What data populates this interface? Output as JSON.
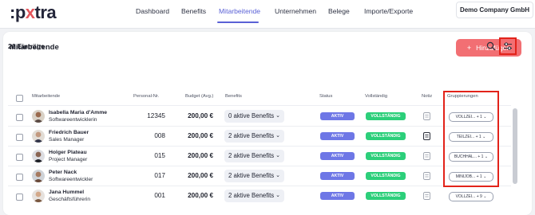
{
  "logo": {
    "pre": ":p",
    "dot": "x",
    "post": "tra"
  },
  "nav": [
    {
      "label": "Dashboard",
      "active": false
    },
    {
      "label": "Benefits",
      "active": false
    },
    {
      "label": "Mitarbeitende",
      "active": true
    },
    {
      "label": "Unternehmen",
      "active": false
    },
    {
      "label": "Belege",
      "active": false
    },
    {
      "label": "Importe/Exporte",
      "active": false
    }
  ],
  "company": "Demo Company GmbH",
  "page": {
    "title": "Mitarbeitende",
    "add_label": "Hinzufügen",
    "count": "26 Einträge"
  },
  "table": {
    "headers": [
      "Mitarbeitende",
      "Personal-Nr.",
      "Budget (Avg.)",
      "Benefits",
      "Status",
      "Vollständig",
      "Notiz",
      "Gruppierungen"
    ],
    "rows": [
      {
        "name": "Isabella Maria d'Amme",
        "role": "Softwareentwicklerin",
        "pnr": "12345",
        "budget": "200,00 €",
        "benefits": "0 aktive Benefits",
        "status": "AKTIV",
        "complete": "VOLLSTÄNDIG",
        "note_filled": false,
        "group": "VOLLZEI... + 1"
      },
      {
        "name": "Friedrich Bauer",
        "role": "Sales Manager",
        "pnr": "008",
        "budget": "200,00 €",
        "benefits": "2 aktive Benefits",
        "status": "AKTIV",
        "complete": "VOLLSTÄNDIG",
        "note_filled": true,
        "group": "TEILZEI... + 1"
      },
      {
        "name": "Holger Plateau",
        "role": "Project Manager",
        "pnr": "015",
        "budget": "200,00 €",
        "benefits": "2 aktive Benefits",
        "status": "AKTIV",
        "complete": "VOLLSTÄNDIG",
        "note_filled": false,
        "group": "BUCHHAL... + 1"
      },
      {
        "name": "Peter Nack",
        "role": "Softwareentwickler",
        "pnr": "017",
        "budget": "200,00 €",
        "benefits": "2 aktive Benefits",
        "status": "AKTIV",
        "complete": "VOLLSTÄNDIG",
        "note_filled": false,
        "group": "MINIJOB... + 1"
      },
      {
        "name": "Jana Hummel",
        "role": "Geschäftsführerin",
        "pnr": "001",
        "budget": "200,00 €",
        "benefits": "2 aktive Benefits",
        "status": "AKTIV",
        "complete": "VOLLSTÄNDIG",
        "note_filled": false,
        "group": "VOLLZEI... + 9"
      }
    ]
  },
  "colors": {
    "accent": "#5a61d6",
    "add_button": "#f26f73",
    "status_active": "#6e77e6",
    "complete": "#2ccf7a",
    "highlight": "#e2231a"
  },
  "icons": [
    "search-icon",
    "filter-settings-icon",
    "note-icon",
    "chevron-down-icon",
    "plus-icon"
  ]
}
